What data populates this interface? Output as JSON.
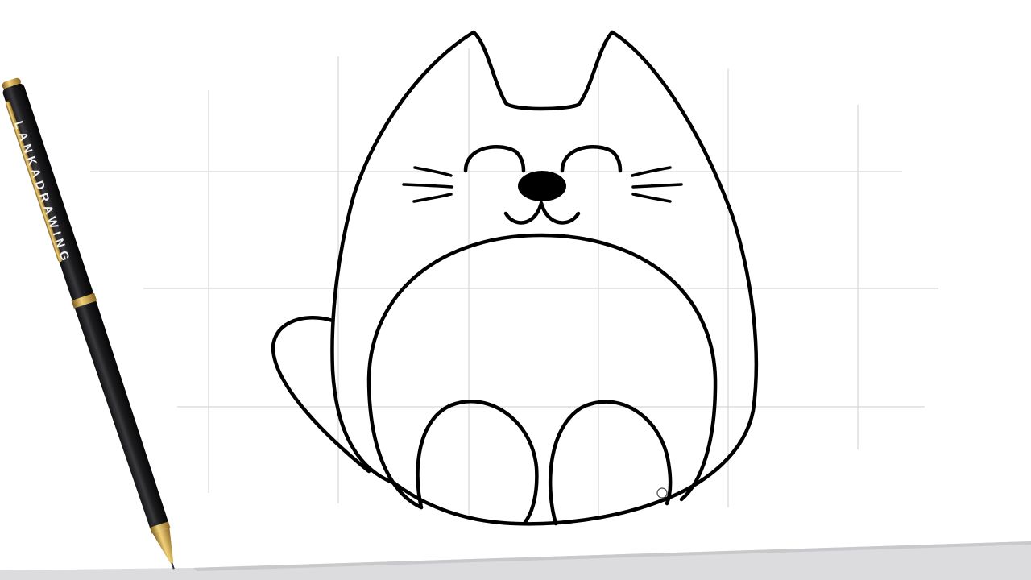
{
  "pen": {
    "brand_text": "LANKADRAWING",
    "body_color": "#1b1b1d",
    "trim_color": "#c9a24a"
  },
  "paper": {
    "background_color": "#ffffff",
    "grid_color": "#d7d7d7",
    "drawing_stroke_color": "#000000"
  },
  "drawing": {
    "subject": "cat-icon"
  }
}
